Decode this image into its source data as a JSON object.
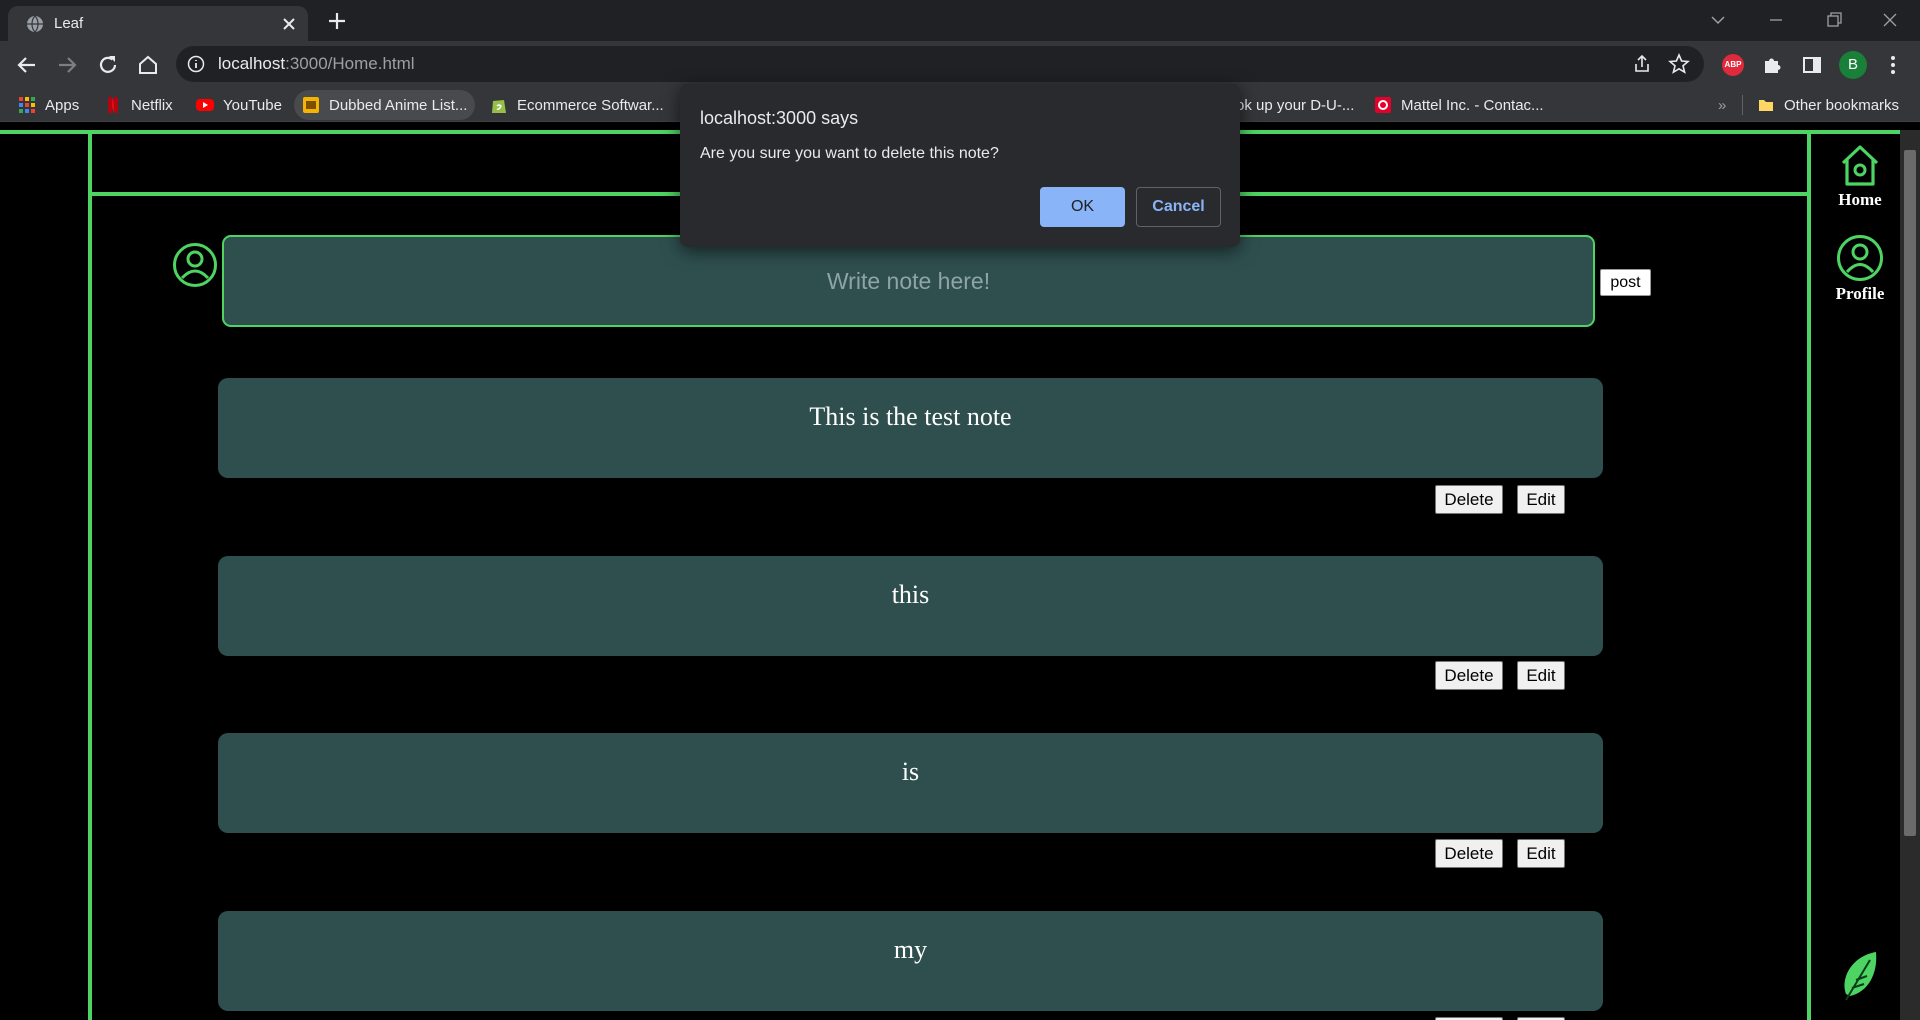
{
  "browser": {
    "tab_title": "Leaf",
    "url_host": "localhost",
    "url_rest": ":3000/Home.html",
    "avatar_letter": "B",
    "extension_label": "ABP",
    "bookmarks": [
      {
        "label": "Apps",
        "icon": "apps-grid-icon"
      },
      {
        "label": "Netflix",
        "icon": "netflix-icon"
      },
      {
        "label": "YouTube",
        "icon": "youtube-icon"
      },
      {
        "label": "Dubbed Anime List...",
        "icon": "bookmark-favicon"
      },
      {
        "label": "Ecommerce Softwar...",
        "icon": "shopify-icon"
      },
      {
        "label": "ok up your D-U-...",
        "icon": ""
      },
      {
        "label": "Mattel Inc. - Contac...",
        "icon": "mattel-icon"
      }
    ],
    "bookmarks_overflow": "»",
    "other_bookmarks": "Other bookmarks"
  },
  "page": {
    "input_placeholder": "Write note here!",
    "post_label": "post",
    "notes": [
      {
        "text": "This is the test note"
      },
      {
        "text": "this"
      },
      {
        "text": "is"
      },
      {
        "text": "my"
      }
    ],
    "delete_label": "Delete",
    "edit_label": "Edit",
    "sidebar": {
      "home_label": "Home",
      "profile_label": "Profile"
    },
    "accent_color": "#4dd463",
    "note_bg_color": "#2f4f4f"
  },
  "dialog": {
    "title": "localhost:3000 says",
    "message": "Are you sure you want to delete this note?",
    "ok_label": "OK",
    "cancel_label": "Cancel"
  }
}
